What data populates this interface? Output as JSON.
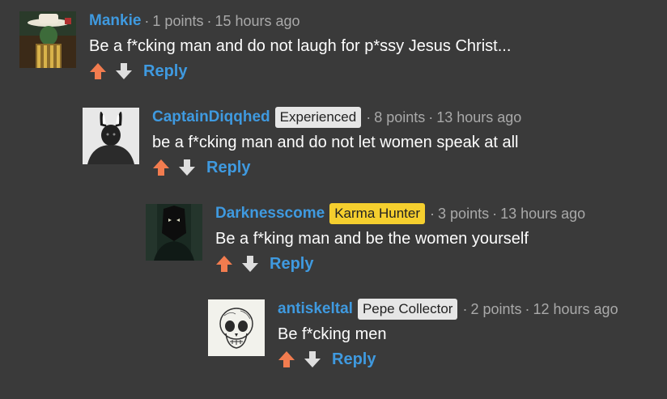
{
  "colors": {
    "background": "#3a3a3a",
    "username": "#3f9ae0",
    "upvote": "#f27c4f",
    "downvote": "#dedede",
    "badge_gray": "#e6e6e6",
    "badge_yellow": "#f5cf2e"
  },
  "comments": [
    {
      "username": "Mankie",
      "badge": "",
      "points": "1 points",
      "time": "15 hours ago",
      "text": "Be a f*cking man and do not laugh for p*ssy Jesus Christ...",
      "reply_label": "Reply",
      "avatar_icon": "cowboy-avatar"
    },
    {
      "username": "CaptainDiqqhed",
      "badge": "Experienced",
      "points": "8 points",
      "time": "13 hours ago",
      "text": "be a f*cking man and do not let women speak at all",
      "reply_label": "Reply",
      "avatar_icon": "bunny-ears-avatar"
    },
    {
      "username": "Darknesscome",
      "badge": "Karma Hunter",
      "points": "3 points",
      "time": "13 hours ago",
      "text": "Be a f*king man and be the women yourself",
      "reply_label": "Reply",
      "avatar_icon": "dark-figure-avatar"
    },
    {
      "username": "antiskeltal",
      "badge": "Pepe Collector",
      "points": "2 points",
      "time": "12 hours ago",
      "text": "Be f*cking men",
      "reply_label": "Reply",
      "avatar_icon": "skull-avatar"
    }
  ]
}
